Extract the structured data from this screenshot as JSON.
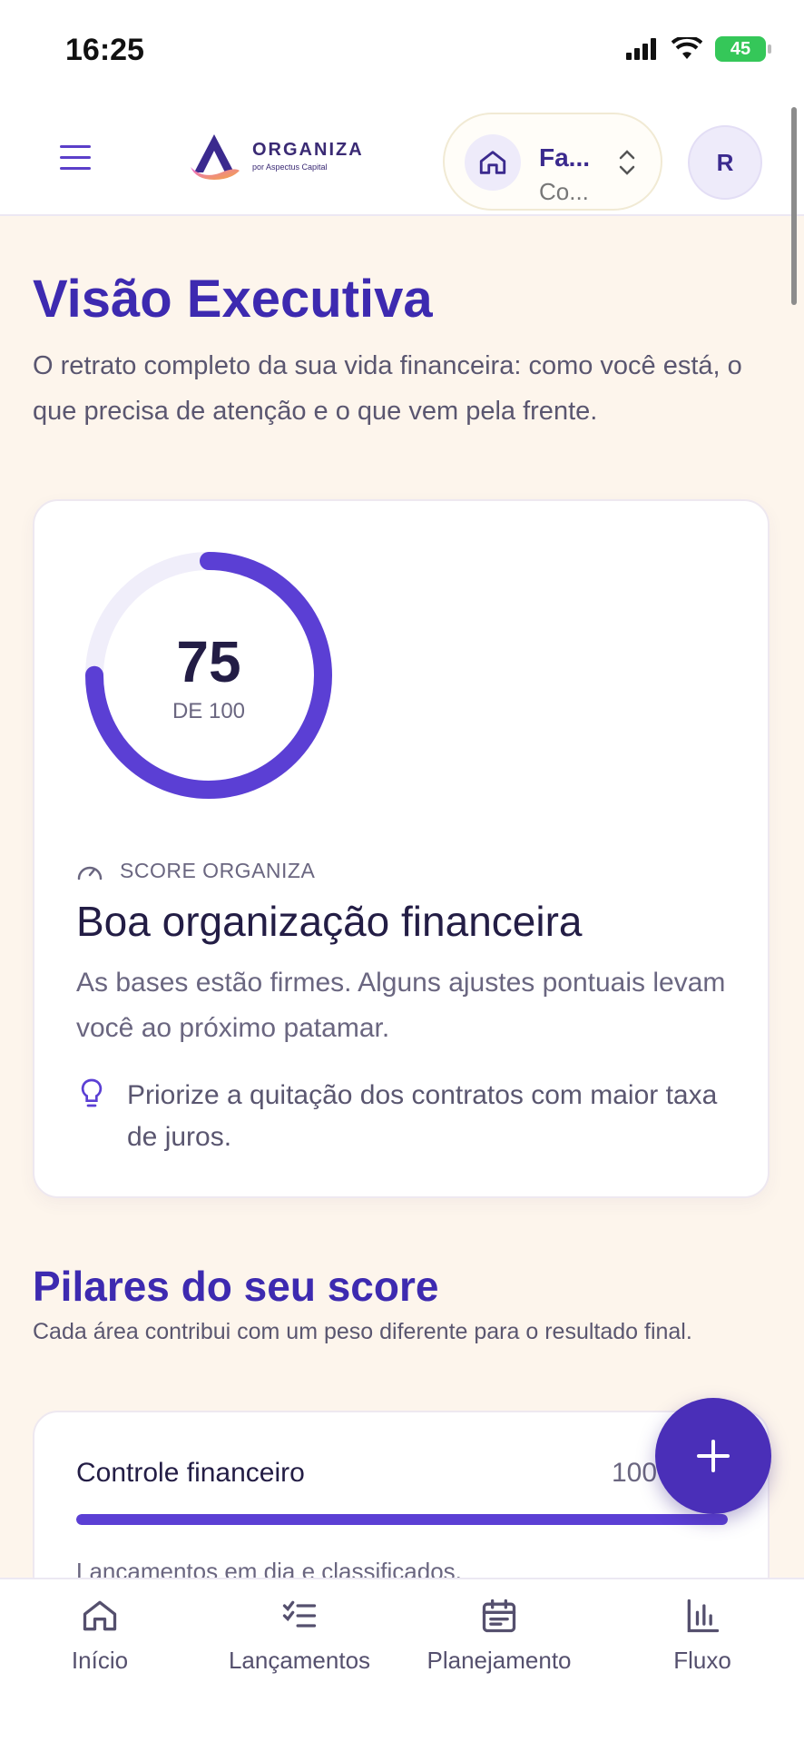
{
  "status_bar": {
    "time": "16:25",
    "battery": "45"
  },
  "header": {
    "logo_name": "ORGANIZA",
    "logo_sub": "por Aspectus Capital",
    "context_title": "Fa...",
    "context_subtitle": "Co...",
    "avatar_initial": "R"
  },
  "page": {
    "title": "Visão Executiva",
    "description": "O retrato completo da sua vida financeira: como você está, o que precisa de atenção e o que vem pela frente."
  },
  "score": {
    "value": "75",
    "denominator": "DE 100",
    "progress_fraction": 0.75,
    "label": "SCORE ORGANIZA",
    "headline": "Boa organização financeira",
    "text": "As bases estão firmes. Alguns ajustes pontuais levam você ao próximo patamar.",
    "tip": "Priorize a quitação dos contratos com maior taxa de juros."
  },
  "pillars_section": {
    "title": "Pilares do seu score",
    "description": "Cada área contribui com um peso diferente para o resultado final.",
    "items": [
      {
        "name": "Controle financeiro",
        "value": "100",
        "progress_fraction": 1.0,
        "description": "Lançamentos em dia e classificados."
      }
    ]
  },
  "bottom_nav": [
    {
      "label": "Início",
      "icon": "home-icon"
    },
    {
      "label": "Lançamentos",
      "icon": "checklist-icon"
    },
    {
      "label": "Planejamento",
      "icon": "calendar-icon"
    },
    {
      "label": "Fluxo",
      "icon": "bar-chart-icon"
    }
  ],
  "colors": {
    "primary": "#4a2fb8",
    "accent_ring": "#5b3fd4",
    "background": "#fdf5ec"
  }
}
